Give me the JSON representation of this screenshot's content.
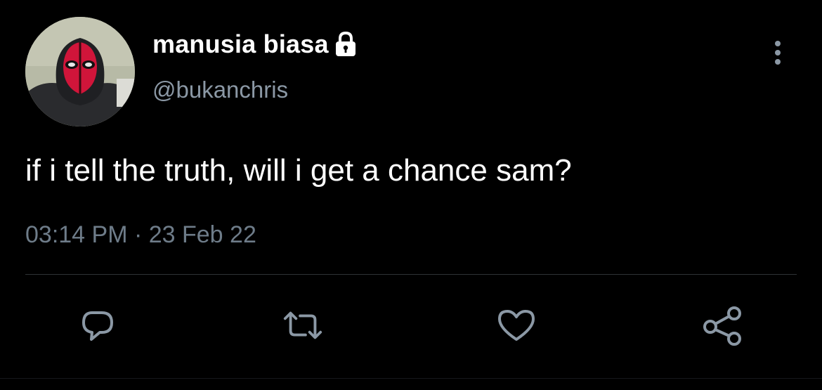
{
  "author": {
    "display_name": "manusia biasa",
    "handle": "@bukanchris",
    "protected": true
  },
  "tweet": {
    "text": "if i tell the truth, will i get a chance sam?",
    "timestamp": "03:14 PM · 23 Feb 22"
  },
  "icons": {
    "lock": "lock-icon",
    "more": "more-vertical-icon",
    "reply": "reply-icon",
    "retweet": "retweet-icon",
    "like": "heart-icon",
    "share": "share-icon"
  },
  "colors": {
    "background": "#000000",
    "primary_text": "#ffffff",
    "secondary_text": "#8b98a5",
    "divider": "#2f3336"
  }
}
